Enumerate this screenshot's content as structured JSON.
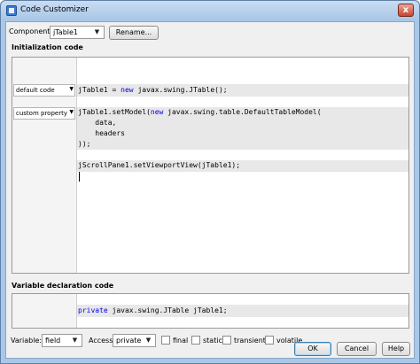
{
  "window": {
    "title": "Code Customizer",
    "close_glyph": "x"
  },
  "component": {
    "label": "Component:",
    "value": "jTable1",
    "rename_label": "Rename..."
  },
  "init_section": {
    "heading": "Initialization code"
  },
  "gutter": {
    "first": "default code",
    "second": "custom property"
  },
  "code_lines": {
    "l1": "jTable1 = new javax.swing.JTable();",
    "l2": "jTable1.setModel(new javax.swing.table.DefaultTableModel(",
    "l3": "    data,",
    "l4": "    headers",
    "l5": "));",
    "l6": "jScrollPane1.setViewportView(jTable1);"
  },
  "var_section": {
    "heading": "Variable declaration code",
    "line": "private javax.swing.JTable jTable1;"
  },
  "options": {
    "variable_label": "Variable:",
    "variable_value": "field",
    "access_label": "Access:",
    "access_value": "private",
    "final_label": "final",
    "static_label": "static",
    "transient_label": "transient",
    "volatile_label": "volatile"
  },
  "buttons": {
    "ok": "OK",
    "cancel": "Cancel",
    "help": "Help"
  }
}
